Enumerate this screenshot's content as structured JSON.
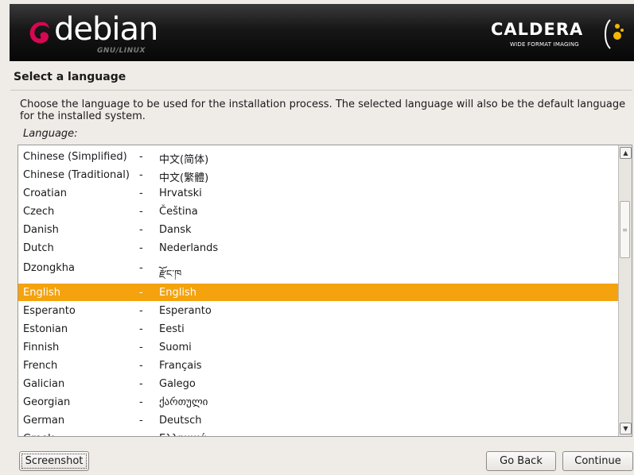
{
  "banner": {
    "logo_word": "debian",
    "logo_sub": "GNU/LINUX",
    "partner_word": "CALDERA",
    "partner_sub": "WIDE FORMAT IMAGING"
  },
  "page": {
    "title": "Select a language",
    "description": "Choose the language to be used for the installation process. The selected language will also be the default language for the installed system.",
    "field_label": "Language:"
  },
  "languages": [
    {
      "name": "Chinese (Simplified)",
      "sep": "-",
      "native": "中文(简体)"
    },
    {
      "name": "Chinese (Traditional)",
      "sep": "-",
      "native": "中文(繁體)"
    },
    {
      "name": "Croatian",
      "sep": "-",
      "native": "Hrvatski"
    },
    {
      "name": "Czech",
      "sep": "-",
      "native": "Čeština"
    },
    {
      "name": "Danish",
      "sep": "-",
      "native": "Dansk"
    },
    {
      "name": "Dutch",
      "sep": "-",
      "native": "Nederlands"
    },
    {
      "name": "Dzongkha",
      "sep": "-",
      "native": "རྫོང་ཁ"
    },
    {
      "name": "English",
      "sep": "-",
      "native": "English",
      "selected": true
    },
    {
      "name": "Esperanto",
      "sep": "-",
      "native": "Esperanto"
    },
    {
      "name": "Estonian",
      "sep": "-",
      "native": "Eesti"
    },
    {
      "name": "Finnish",
      "sep": "-",
      "native": "Suomi"
    },
    {
      "name": "French",
      "sep": "-",
      "native": "Français"
    },
    {
      "name": "Galician",
      "sep": "-",
      "native": "Galego"
    },
    {
      "name": "Georgian",
      "sep": "-",
      "native": "ქართული"
    },
    {
      "name": "German",
      "sep": "-",
      "native": "Deutsch"
    },
    {
      "name": "Greek",
      "sep": "-",
      "native": "Ελληνικά"
    }
  ],
  "buttons": {
    "screenshot": "Screenshot",
    "back": "Go Back",
    "continue": "Continue"
  },
  "colors": {
    "selection": "#f4a20d",
    "debian_red": "#d70751",
    "caldera_yellow": "#f4b800"
  },
  "icons": {
    "scroll_up": "triangle-up",
    "scroll_down": "triangle-down"
  }
}
